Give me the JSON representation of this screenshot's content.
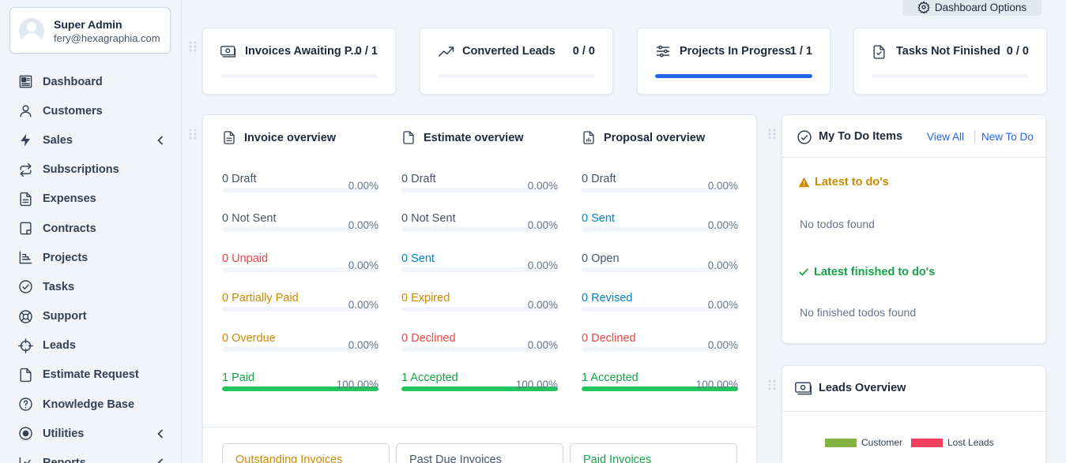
{
  "profile": {
    "name": "Super Admin",
    "email": "fery@hexagraphia.com"
  },
  "sidebar": {
    "items": [
      {
        "label": "Dashboard",
        "icon": "dashboard-icon",
        "chevron": false
      },
      {
        "label": "Customers",
        "icon": "user-icon",
        "chevron": false
      },
      {
        "label": "Sales",
        "icon": "bolt-icon",
        "chevron": true
      },
      {
        "label": "Subscriptions",
        "icon": "repeat-icon",
        "chevron": false
      },
      {
        "label": "Expenses",
        "icon": "file-text-icon",
        "chevron": false
      },
      {
        "label": "Contracts",
        "icon": "contract-icon",
        "chevron": false
      },
      {
        "label": "Projects",
        "icon": "chart-icon",
        "chevron": false
      },
      {
        "label": "Tasks",
        "icon": "check-circle-icon",
        "chevron": false
      },
      {
        "label": "Support",
        "icon": "lifebuoy-icon",
        "chevron": false
      },
      {
        "label": "Leads",
        "icon": "crosshair-icon",
        "chevron": false
      },
      {
        "label": "Estimate Request",
        "icon": "document-icon",
        "chevron": false
      },
      {
        "label": "Knowledge Base",
        "icon": "question-icon",
        "chevron": false
      },
      {
        "label": "Utilities",
        "icon": "record-icon",
        "chevron": true
      },
      {
        "label": "Reports",
        "icon": "trend-icon",
        "chevron": true
      }
    ]
  },
  "header": {
    "dashboard_options": "Dashboard Options"
  },
  "stats": [
    {
      "label": "Invoices Awaiting P...",
      "value": "0 / 1",
      "progress": 0,
      "icon": "money-icon"
    },
    {
      "label": "Converted Leads",
      "value": "0 / 0",
      "progress": 0,
      "icon": "trending-up-icon"
    },
    {
      "label": "Projects In Progress",
      "value": "1 / 1",
      "progress": 1,
      "icon": "sliders-icon"
    },
    {
      "label": "Tasks Not Finished",
      "value": "0 / 0",
      "progress": 0,
      "icon": "file-check-icon"
    }
  ],
  "overview": {
    "columns": [
      {
        "title": "Invoice overview",
        "rows": [
          {
            "label": "0 Draft",
            "pct": "0.00%",
            "progress": 0,
            "color": "gray"
          },
          {
            "label": "0 Not Sent",
            "pct": "0.00%",
            "progress": 0,
            "color": "gray"
          },
          {
            "label": "0 Unpaid",
            "pct": "0.00%",
            "progress": 0,
            "color": "red"
          },
          {
            "label": "0 Partially Paid",
            "pct": "0.00%",
            "progress": 0,
            "color": "amber"
          },
          {
            "label": "0 Overdue",
            "pct": "0.00%",
            "progress": 0,
            "color": "amber"
          },
          {
            "label": "1 Paid",
            "pct": "100.00%",
            "progress": 1,
            "color": "green"
          }
        ]
      },
      {
        "title": "Estimate overview",
        "rows": [
          {
            "label": "0 Draft",
            "pct": "0.00%",
            "progress": 0,
            "color": "gray"
          },
          {
            "label": "0 Not Sent",
            "pct": "0.00%",
            "progress": 0,
            "color": "gray"
          },
          {
            "label": "0 Sent",
            "pct": "0.00%",
            "progress": 0,
            "color": "blue"
          },
          {
            "label": "0 Expired",
            "pct": "0.00%",
            "progress": 0,
            "color": "amber"
          },
          {
            "label": "0 Declined",
            "pct": "0.00%",
            "progress": 0,
            "color": "red"
          },
          {
            "label": "1 Accepted",
            "pct": "100.00%",
            "progress": 1,
            "color": "green"
          }
        ]
      },
      {
        "title": "Proposal overview",
        "rows": [
          {
            "label": "0 Draft",
            "pct": "0.00%",
            "progress": 0,
            "color": "gray"
          },
          {
            "label": "0 Sent",
            "pct": "0.00%",
            "progress": 0,
            "color": "blue"
          },
          {
            "label": "0 Open",
            "pct": "0.00%",
            "progress": 0,
            "color": "gray"
          },
          {
            "label": "0 Revised",
            "pct": "0.00%",
            "progress": 0,
            "color": "blue"
          },
          {
            "label": "0 Declined",
            "pct": "0.00%",
            "progress": 0,
            "color": "red"
          },
          {
            "label": "1 Accepted",
            "pct": "100.00%",
            "progress": 1,
            "color": "green"
          }
        ]
      }
    ],
    "tabs": [
      {
        "label": "Outstanding Invoices",
        "color": "amber"
      },
      {
        "label": "Past Due Invoices",
        "color": "gray"
      },
      {
        "label": "Paid Invoices",
        "color": "green"
      }
    ]
  },
  "todo": {
    "title": "My To Do Items",
    "view_all": "View All",
    "new_todo": "New To Do",
    "latest_title": "Latest to do's",
    "latest_empty": "No todos found",
    "finished_title": "Latest finished to do's",
    "finished_empty": "No finished todos found"
  },
  "leads": {
    "title": "Leads Overview",
    "legend": [
      {
        "label": "Customer",
        "color": "#84b33f"
      },
      {
        "label": "Lost Leads",
        "color": "#f43f5e"
      }
    ]
  },
  "colors": {
    "accent": "#2563eb",
    "success": "#22c55e"
  }
}
